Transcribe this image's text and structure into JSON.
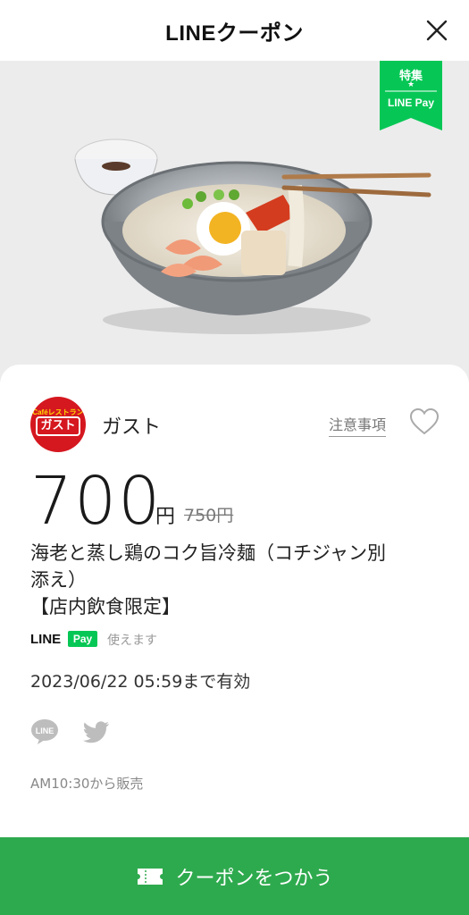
{
  "header": {
    "title": "LINEクーポン",
    "close_icon": "close-icon"
  },
  "hero": {
    "ribbon_top": "特集",
    "ribbon_star": "★",
    "ribbon_bottom": "LINE Pay",
    "ribbon_color": "#06c755"
  },
  "shop": {
    "logo_top": "Caféレストラン",
    "logo_main": "ガスト",
    "name": "ガスト",
    "notes_link": "注意事項"
  },
  "price": {
    "current": "700",
    "currency": "円",
    "original": "750円"
  },
  "coupon": {
    "title_line1": "海老と蒸し鶏のコク旨冷麺（コチジャン別",
    "title_line2": "添え）",
    "title_line3": "【店内飲食限定】"
  },
  "payment": {
    "line_text": "LINE",
    "pay_text": "Pay",
    "note": "使えます"
  },
  "expiry": "2023/06/22  05:59まで有効",
  "share": {
    "line_icon": "line-share-icon",
    "twitter_icon": "twitter-share-icon"
  },
  "sale_time": "AM10:30から販売",
  "use_button": {
    "label": "クーポンをつかう",
    "color": "#2eaa4e"
  }
}
